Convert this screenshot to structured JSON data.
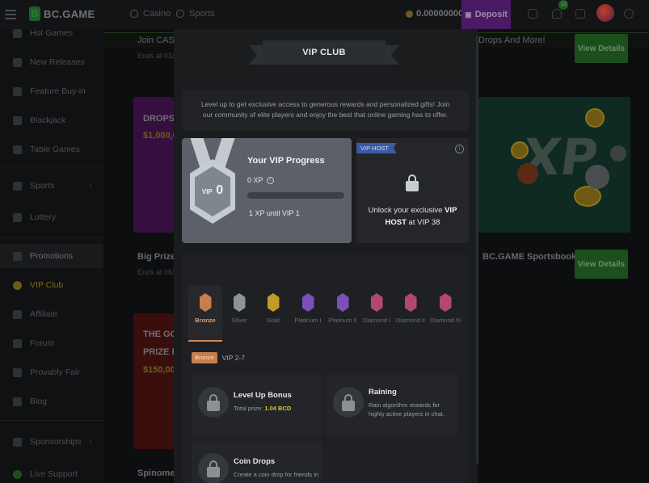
{
  "header": {
    "logo_text": "BC.GAME",
    "nav": [
      {
        "label": "Casino"
      },
      {
        "label": "Sports"
      }
    ],
    "balance": "0.00000000",
    "deposit_label": "Deposit",
    "notification_count": "12"
  },
  "sidebar": {
    "items": [
      {
        "label": "Hot Games"
      },
      {
        "label": "New Releases"
      },
      {
        "label": "Feature Buy-in"
      },
      {
        "label": "Blackjack"
      },
      {
        "label": "Table Games"
      },
      {
        "label": "Sports"
      },
      {
        "label": "Lottery"
      },
      {
        "label": "Promotions"
      },
      {
        "label": "VIP Club"
      },
      {
        "label": "Affiliate"
      },
      {
        "label": "Forum"
      },
      {
        "label": "Provably Fair"
      },
      {
        "label": "Blog"
      },
      {
        "label": "Sponsorships"
      },
      {
        "label": "Live Support"
      }
    ]
  },
  "background": {
    "banner_left": "Join CASH",
    "banner_right": "Drops And More!",
    "ends_1": "Ends at 01/0",
    "view_details_1": "View Details",
    "drops_title": "DROPS &",
    "drops_amount": "$1,000,0",
    "big_prize": "Big Prize P",
    "ends_2": "Ends at 06/0",
    "sportsbook": "BC.GAME Sportsbook",
    "view_details_2": "View Details",
    "gold_title_1": "THE GOL",
    "gold_title_2": "PRIZE PO",
    "gold_amount": "$150,00",
    "spinomenal": "Spinomena",
    "xp_art_text": "XP"
  },
  "modal": {
    "title": "VIP CLUB",
    "intro": "Level up to get exclusive access to generous rewards and personalized gifts! Join our community of elite players and enjoy the best that online gaming has to offer.",
    "progress": {
      "title": "Your VIP Progress",
      "xp": "0 XP",
      "fraction": 0,
      "until": "1 XP until VIP 1",
      "medal_prefix": "VIP",
      "medal_level": "0"
    },
    "host": {
      "tag": "VIP HOST",
      "text_prefix": "Unlock your exclusive ",
      "text_vip": "VIP",
      "text_host": "HOST",
      "text_suffix": " at VIP 38"
    },
    "tiers": [
      {
        "label": "Bronze",
        "color": "#c57e4d",
        "active": true
      },
      {
        "label": "Silver",
        "color": "#8f9297"
      },
      {
        "label": "Gold",
        "color": "#c39a2c"
      },
      {
        "label": "Platinum I",
        "color": "#7d4fb8"
      },
      {
        "label": "Platinum II",
        "color": "#7d4fb8"
      },
      {
        "label": "Diamond I",
        "color": "#b2486f"
      },
      {
        "label": "Diamond II",
        "color": "#b2486f"
      },
      {
        "label": "Diamond III",
        "color": "#b2486f"
      }
    ],
    "level": {
      "tag": "Bronze",
      "range": "VIP 2-7"
    },
    "perks": [
      {
        "title": "Level Up Bonus",
        "sub_prefix": "Total prize: ",
        "amount": "1.04 BCD"
      },
      {
        "title": "Raining",
        "sub": "Rain algorithm rewards for highly active players in chat."
      },
      {
        "title": "Coin Drops",
        "sub": "Create a coin drop for friends in"
      }
    ]
  },
  "colors": {
    "accent_green": "#1d4f1c",
    "deposit_purple": "#4a1a66",
    "bronze": "#c57e4d",
    "gold_amount": "#d6c531",
    "host_tag": "#3a5aa2"
  }
}
